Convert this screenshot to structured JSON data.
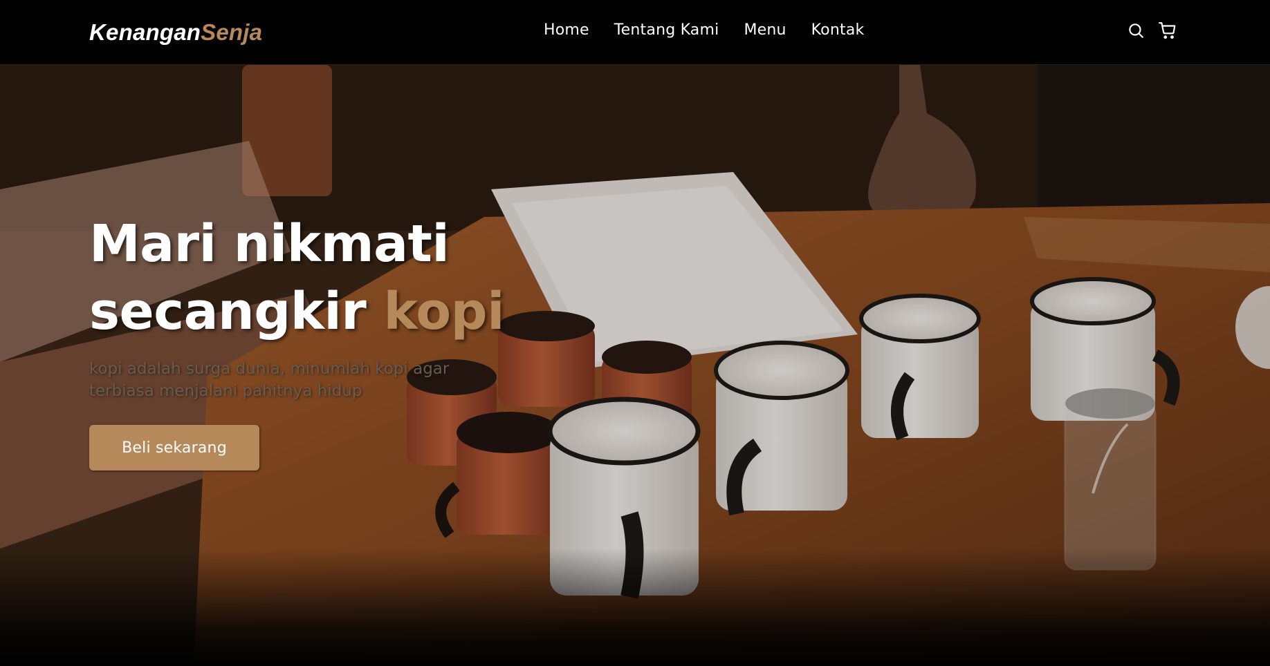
{
  "brand": {
    "part1": "Kenangan",
    "part2": "Senja"
  },
  "nav": {
    "links": [
      {
        "label": "Home"
      },
      {
        "label": "Tentang Kami"
      },
      {
        "label": "Menu"
      },
      {
        "label": "Kontak"
      }
    ],
    "icons": [
      "search-icon",
      "shopping-cart-icon"
    ]
  },
  "hero": {
    "title_line1": "Mari nikmati",
    "title_line2_plain": "secangkir ",
    "title_line2_accent": "kopi",
    "subtitle": "kopi adalah surga dunia, minumlah kopi agar terbiasa menjalani pahitnya hidup",
    "cta_label": "Beli sekarang"
  },
  "colors": {
    "background": "#010101",
    "accent": "#b6895b",
    "text": "#ffffff",
    "subtitle": "#6a5b4f"
  }
}
